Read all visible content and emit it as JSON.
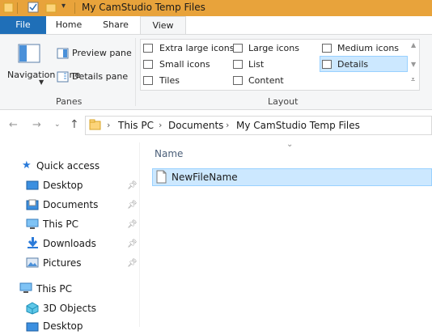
{
  "window": {
    "title": "My CamStudio Temp Files"
  },
  "ribbon": {
    "tabs": [
      {
        "label": "File"
      },
      {
        "label": "Home"
      },
      {
        "label": "Share"
      },
      {
        "label": "View"
      }
    ],
    "panes": {
      "navigation_pane": "Navigation pane",
      "preview_pane": "Preview pane",
      "details_pane": "Details pane",
      "group_label": "Panes"
    },
    "layout": {
      "extra_large_icons": "Extra large icons",
      "large_icons": "Large icons",
      "medium_icons": "Medium icons",
      "small_icons": "Small icons",
      "list": "List",
      "details": "Details",
      "tiles": "Tiles",
      "content": "Content",
      "group_label": "Layout",
      "selected": "Details"
    }
  },
  "address": {
    "crumbs": [
      "This PC",
      "Documents",
      "My CamStudio Temp Files"
    ]
  },
  "sidebar": {
    "quick_access": "Quick access",
    "items": [
      {
        "label": "Desktop",
        "icon": "desktop-icon"
      },
      {
        "label": "Documents",
        "icon": "documents-icon"
      },
      {
        "label": "This PC",
        "icon": "computer-icon"
      },
      {
        "label": "Downloads",
        "icon": "download-icon"
      },
      {
        "label": "Pictures",
        "icon": "pictures-icon"
      }
    ],
    "this_pc": "This PC",
    "objects_3d": "3D Objects",
    "desktop_cut": "Desktop"
  },
  "content": {
    "column_name": "Name",
    "files": [
      {
        "name": "NewFileName",
        "icon": "text-file-icon"
      }
    ]
  },
  "colors": {
    "titlebar": "#e8a33b",
    "file_tab": "#1f6fb8",
    "selection": "#cce8ff",
    "selection_border": "#99d1ff"
  }
}
